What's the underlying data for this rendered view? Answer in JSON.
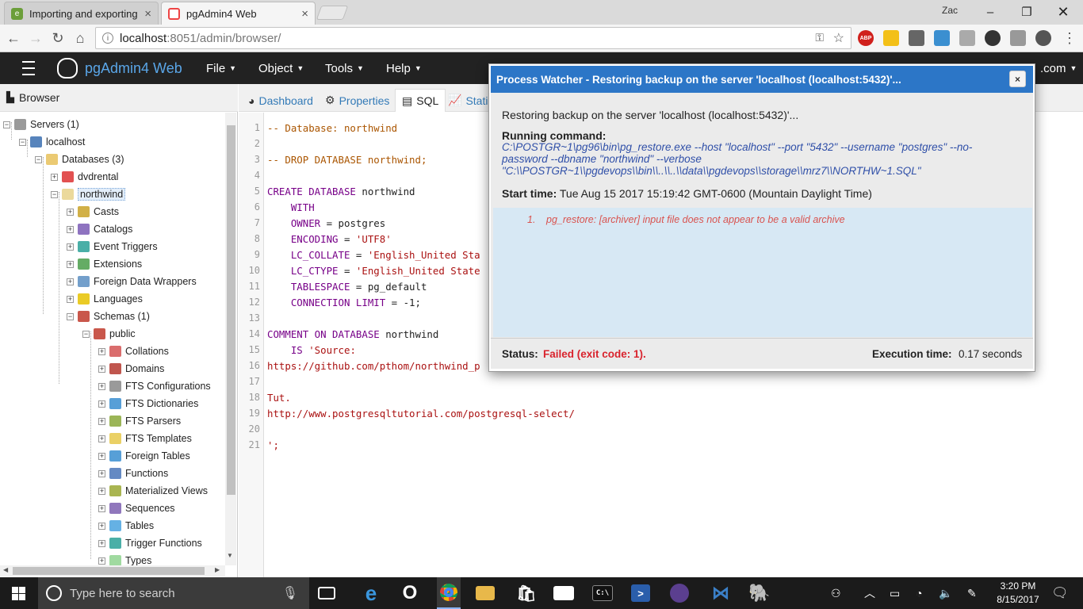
{
  "browser_tabs": [
    {
      "title": "Importing and exporting",
      "active": false
    },
    {
      "title": "pgAdmin4 Web",
      "active": true
    }
  ],
  "window_user": "Zac",
  "address": {
    "host": "localhost",
    "rest": ":8051/admin/browser/"
  },
  "navbar": {
    "brand": "pgAdmin4 Web",
    "menus": [
      "File",
      "Object",
      "Tools",
      "Help"
    ],
    "right_text": ".com"
  },
  "browser_panel": {
    "title": "Browser",
    "tree": [
      {
        "label": "Servers (1)"
      },
      {
        "label": "localhost"
      },
      {
        "label": "Databases (3)"
      },
      {
        "label": "dvdrental"
      },
      {
        "label": "northwind"
      },
      {
        "label": "Casts"
      },
      {
        "label": "Catalogs"
      },
      {
        "label": "Event Triggers"
      },
      {
        "label": "Extensions"
      },
      {
        "label": "Foreign Data Wrappers"
      },
      {
        "label": "Languages"
      },
      {
        "label": "Schemas (1)"
      },
      {
        "label": "public"
      },
      {
        "label": "Collations"
      },
      {
        "label": "Domains"
      },
      {
        "label": "FTS Configurations"
      },
      {
        "label": "FTS Dictionaries"
      },
      {
        "label": "FTS Parsers"
      },
      {
        "label": "FTS Templates"
      },
      {
        "label": "Foreign Tables"
      },
      {
        "label": "Functions"
      },
      {
        "label": "Materialized Views"
      },
      {
        "label": "Sequences"
      },
      {
        "label": "Tables"
      },
      {
        "label": "Trigger Functions"
      },
      {
        "label": "Types"
      }
    ]
  },
  "main_tabs": [
    "Dashboard",
    "Properties",
    "SQL",
    "Statis"
  ],
  "sql_lines": [
    {
      "n": "1",
      "parts": [
        [
          "cm",
          "-- Database: northwind"
        ]
      ]
    },
    {
      "n": "2",
      "parts": []
    },
    {
      "n": "3",
      "parts": [
        [
          "cm",
          "-- DROP DATABASE northwind;"
        ]
      ]
    },
    {
      "n": "4",
      "parts": []
    },
    {
      "n": "5",
      "parts": [
        [
          "kw",
          "CREATE DATABASE"
        ],
        [
          "",
          " northwind"
        ]
      ]
    },
    {
      "n": "6",
      "parts": [
        [
          "kw",
          "    WITH"
        ]
      ]
    },
    {
      "n": "7",
      "parts": [
        [
          "kw",
          "    OWNER"
        ],
        [
          "",
          " = postgres"
        ]
      ]
    },
    {
      "n": "8",
      "parts": [
        [
          "kw",
          "    ENCODING"
        ],
        [
          "",
          " = "
        ],
        [
          "st",
          "'UTF8'"
        ]
      ]
    },
    {
      "n": "9",
      "parts": [
        [
          "kw",
          "    LC_COLLATE"
        ],
        [
          "",
          " = "
        ],
        [
          "st",
          "'English_United Sta"
        ]
      ]
    },
    {
      "n": "10",
      "parts": [
        [
          "kw",
          "    LC_CTYPE"
        ],
        [
          "",
          " = "
        ],
        [
          "st",
          "'English_United State"
        ]
      ]
    },
    {
      "n": "11",
      "parts": [
        [
          "kw",
          "    TABLESPACE"
        ],
        [
          "",
          " = pg_default"
        ]
      ]
    },
    {
      "n": "12",
      "parts": [
        [
          "kw",
          "    CONNECTION LIMIT"
        ],
        [
          "",
          " = -1;"
        ]
      ]
    },
    {
      "n": "13",
      "parts": []
    },
    {
      "n": "14",
      "parts": [
        [
          "kw",
          "COMMENT ON DATABASE"
        ],
        [
          "",
          " northwind"
        ]
      ]
    },
    {
      "n": "15",
      "parts": [
        [
          "kw",
          "    IS"
        ],
        [
          "st",
          " 'Source:"
        ]
      ]
    },
    {
      "n": "16",
      "parts": [
        [
          "ur",
          "https://github.com/pthom/northwind_p"
        ]
      ]
    },
    {
      "n": "17",
      "parts": []
    },
    {
      "n": "18",
      "parts": [
        [
          "ur",
          "Tut."
        ]
      ]
    },
    {
      "n": "19",
      "parts": [
        [
          "ur",
          "http://www.postgresqltutorial.com/postgresql-select/"
        ]
      ]
    },
    {
      "n": "20",
      "parts": []
    },
    {
      "n": "21",
      "parts": [
        [
          "st",
          "';"
        ]
      ]
    }
  ],
  "dialog": {
    "title": "Process Watcher - Restoring backup on the server 'localhost (localhost:5432)'...",
    "message": "Restoring backup on the server 'localhost (localhost:5432)'...",
    "running_label": "Running command:",
    "command_lines": [
      "C:\\POSTGR~1\\pg96\\bin\\pg_restore.exe --host \"localhost\" --port \"5432\" --username \"postgres\" --no-",
      "password --dbname \"northwind\" --verbose",
      "\"C:\\\\POSTGR~1\\\\pgdevops\\\\bin\\\\..\\\\..\\\\data\\\\pgdevops\\\\storage\\\\mrz7\\\\NORTHW~1.SQL\""
    ],
    "start_label": "Start time:",
    "start_value": "Tue Aug 15 2017 15:19:42 GMT-0600 (Mountain Daylight Time)",
    "log_number": "1.",
    "log_text": "pg_restore: [archiver] input file does not appear to be a valid archive",
    "status_label": "Status:",
    "status_value": "Failed (exit code: 1).",
    "exec_label": "Execution time:",
    "exec_value": "0.17 seconds",
    "close_glyph": "×"
  },
  "taskbar": {
    "search_placeholder": "Type here to search",
    "time": "3:20 PM",
    "date": "8/15/2017"
  },
  "colors": {
    "accent": "#2c76c7",
    "failed": "#d9232d",
    "log_text": "#d9534f",
    "navbar": "#222222",
    "brand": "#5aa6e8"
  }
}
